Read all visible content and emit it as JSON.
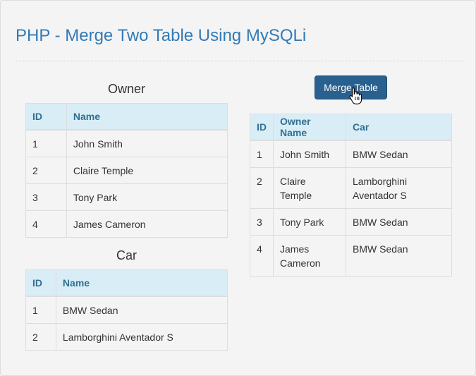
{
  "page": {
    "title": "PHP - Merge Two Table Using MySQLi"
  },
  "owner_table": {
    "caption": "Owner",
    "headers": [
      "ID",
      "Name"
    ],
    "rows": [
      [
        "1",
        "John Smith"
      ],
      [
        "2",
        "Claire Temple"
      ],
      [
        "3",
        "Tony Park"
      ],
      [
        "4",
        "James Cameron"
      ]
    ]
  },
  "car_table": {
    "caption": "Car",
    "headers": [
      "ID",
      "Name"
    ],
    "rows": [
      [
        "1",
        "BMW Sedan"
      ],
      [
        "2",
        "Lamborghini Aventador S"
      ]
    ]
  },
  "merge": {
    "button_label": "Merge Table",
    "headers": [
      "ID",
      "Owner Name",
      "Car"
    ],
    "rows": [
      [
        "1",
        "John Smith",
        "BMW Sedan"
      ],
      [
        "2",
        "Claire Temple",
        "Lamborghini Aventador S"
      ],
      [
        "3",
        "Tony Park",
        "BMW Sedan"
      ],
      [
        "4",
        "James Cameron",
        "BMW Sedan"
      ]
    ]
  },
  "cursor": {
    "icon": "hand-pointer-icon"
  },
  "colors": {
    "title": "#337ab7",
    "header_bg": "#d9edf7",
    "header_text": "#31708f",
    "button_bg": "#286090"
  }
}
